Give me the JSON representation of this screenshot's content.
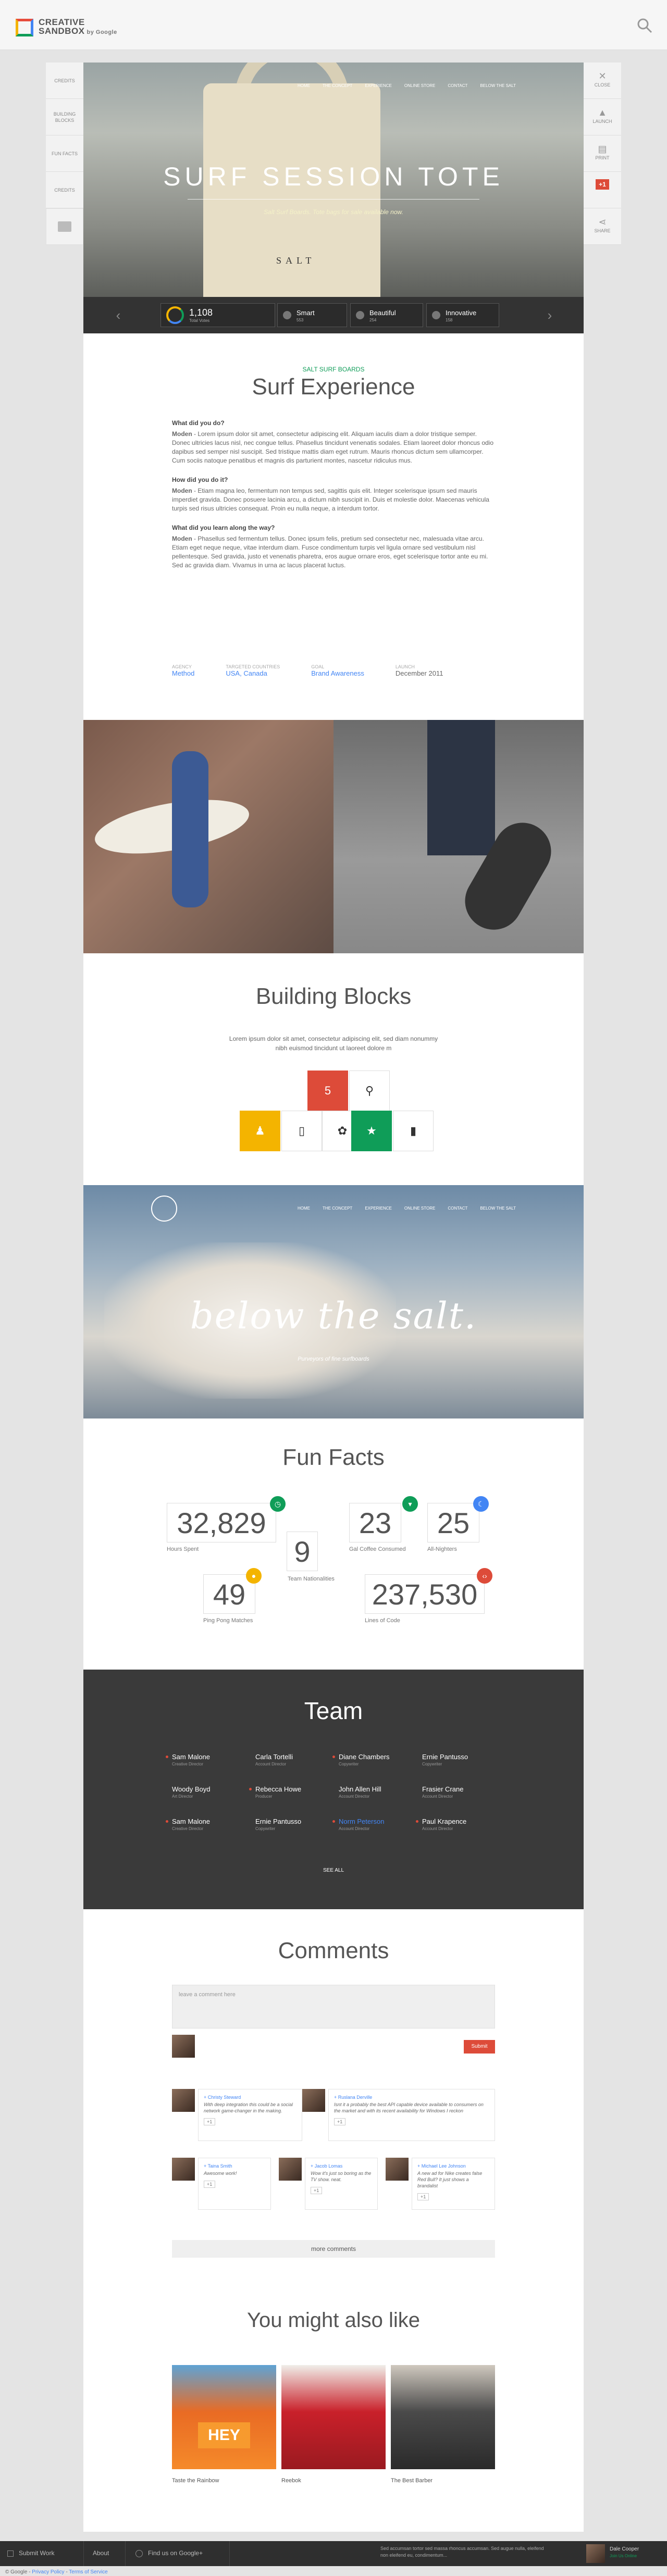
{
  "header": {
    "logo_line1": "CREATIVE",
    "logo_line2": "SANDBOX",
    "logo_by": "by Google"
  },
  "left_tabs": [
    "Credits",
    "Building Blocks",
    "Fun Facts",
    "Credits"
  ],
  "right_tabs": [
    {
      "icon": "close-icon",
      "label": "Close"
    },
    {
      "icon": "launch-icon",
      "label": "Launch"
    },
    {
      "icon": "print-icon",
      "label": "Print"
    },
    {
      "icon": "gplus-icon",
      "label": "+1"
    },
    {
      "icon": "share-icon",
      "label": "Share"
    }
  ],
  "hero": {
    "nav": [
      "Home",
      "The Concept",
      "Experience",
      "Online Store",
      "Contact",
      "Below the Salt"
    ],
    "title": "SURF SESSION TOTE",
    "subtitle": "Salt Surf Boards. Tote bags for sale available now."
  },
  "statbar": {
    "count": "1,108",
    "count_caption": "Total Votes",
    "items": [
      {
        "label": "Smart",
        "caption": "553"
      },
      {
        "label": "Beautiful",
        "caption": "254"
      },
      {
        "label": "Innovative",
        "caption": "158"
      }
    ]
  },
  "experience": {
    "tag": "Salt Surf Boards",
    "title": "Surf Experience",
    "sections": [
      {
        "q": "What did you do?",
        "lead": "Moden",
        "text": " - Lorem ipsum dolor sit amet, consectetur adipiscing elit. Aliquam iaculis diam a dolor tristique semper. Donec ultricies lacus nisl, nec congue tellus. Phasellus tincidunt venenatis sodales. Etiam laoreet dolor rhoncus odio dapibus sed semper nisl suscipit. Sed tristique mattis diam eget rutrum. Mauris rhoncus dictum sem ullamcorper. Cum sociis natoque penatibus et magnis dis parturient montes, nascetur ridiculus mus."
      },
      {
        "q": "How did you do it?",
        "lead": "Moden",
        "text": " - Etiam magna leo, fermentum non tempus sed, sagittis quis elit. Integer scelerisque ipsum sed mauris imperdiet gravida. Donec posuere lacinia arcu, a dictum nibh suscipit in. Duis et molestie dolor. Maecenas vehicula turpis sed risus ultricies consequat. Proin eu nulla neque, a interdum tortor."
      },
      {
        "q": "What did you learn along the way?",
        "lead": "Moden",
        "text": " - Phasellus sed fermentum tellus. Donec ipsum felis, pretium sed consectetur nec, malesuada vitae arcu. Etiam eget neque neque, vitae interdum diam. Fusce condimentum turpis vel ligula ornare sed vestibulum nisl pellentesque. Sed gravida, justo et venenatis pharetra, eros augue ornare eros, eget scelerisque tortor ante eu mi. Sed ac gravida diam. Vivamus in urna ac lacus placerat luctus."
      }
    ],
    "meta": [
      {
        "label": "Agency",
        "value": "Method",
        "link": true
      },
      {
        "label": "Targeted Countries",
        "value": "USA, Canada",
        "link": true
      },
      {
        "label": "Goal",
        "value": "Brand Awareness",
        "link": true
      },
      {
        "label": "Launch",
        "value": "December 2011",
        "link": false
      }
    ]
  },
  "building_blocks": {
    "title": "Building Blocks",
    "text": "Lorem ipsum dolor sit amet, consectetur adipiscing elit, sed diam nonummy nibh euismod tincidunt ut laoreet dolore m",
    "blocks": [
      {
        "icon": "html5-icon",
        "glyph": "5"
      },
      {
        "icon": "map-pin-icon",
        "glyph": "⚲"
      },
      {
        "icon": "android-icon",
        "glyph": "♟"
      },
      {
        "icon": "mobile-icon",
        "glyph": "▯"
      },
      {
        "icon": "chrome-icon",
        "glyph": "✿"
      },
      {
        "icon": "star-icon",
        "glyph": "★"
      },
      {
        "icon": "mouse-icon",
        "glyph": "▮"
      }
    ]
  },
  "salt": {
    "nav": [
      "Home",
      "The Concept",
      "Experience",
      "Online Store",
      "Contact",
      "Below the Salt"
    ],
    "script": "below the salt.",
    "sub": "Purveyors of fine surfboards"
  },
  "fun_facts": {
    "title": "Fun Facts",
    "facts": [
      {
        "value": "32,829",
        "label": "Hours Spent"
      },
      {
        "value": "9",
        "label": "Team Nationalities"
      },
      {
        "value": "23",
        "label": "Gal Coffee Consumed"
      },
      {
        "value": "25",
        "label": "All-Nighters"
      },
      {
        "value": "49",
        "label": "Ping Pong Matches"
      },
      {
        "value": "237,530",
        "label": "Lines of Code"
      }
    ]
  },
  "team": {
    "title": "Team",
    "members": [
      {
        "name": "Sam Malone",
        "role": "Creative Director"
      },
      {
        "name": "Carla Tortelli",
        "role": "Account Director"
      },
      {
        "name": "Diane Chambers",
        "role": "Copywriter"
      },
      {
        "name": "Ernie Pantusso",
        "role": "Copywriter"
      },
      {
        "name": "Woody Boyd",
        "role": "Art Director"
      },
      {
        "name": "Rebecca Howe",
        "role": "Producer"
      },
      {
        "name": "John Allen Hill",
        "role": "Account Director"
      },
      {
        "name": "Frasier Crane",
        "role": "Account Director"
      },
      {
        "name": "Sam Malone",
        "role": "Creative Director"
      },
      {
        "name": "Ernie Pantusso",
        "role": "Copywriter"
      },
      {
        "name": "Norm Peterson",
        "role": "Account Director"
      },
      {
        "name": "Paul Krapence",
        "role": "Account Director"
      }
    ],
    "see_all": "See All"
  },
  "comments": {
    "title": "Comments",
    "placeholder": "leave a comment here",
    "submit": "Submit",
    "items": [
      {
        "name": "+ Christy Steward",
        "text": "With deep integration this could be a social network game-changer in the making.",
        "plus": "+1"
      },
      {
        "name": "+ Ruslana Derville",
        "text": "Isnt it a probably the best API capable device available to consumers on the market and with its recent availability for Windows I reckon",
        "plus": "+1"
      },
      {
        "name": "+ Taina Smith",
        "text": "Awesome work!",
        "plus": "+1"
      },
      {
        "name": "+ Jacob Lomas",
        "text": "Wow it's just so boring as the TV show. neat.",
        "plus": "+1"
      },
      {
        "name": "+ Michael Lee Johnson",
        "text": "A new ad for Nike creates false Red Bull? It just shows a brandalist",
        "plus": "+1"
      }
    ],
    "more": "more comments"
  },
  "also_like": {
    "title": "You might also like",
    "items": [
      {
        "caption": "Taste the Rainbow",
        "badge": "HEY"
      },
      {
        "caption": "Reebok"
      },
      {
        "caption": "The Best Barber"
      }
    ]
  },
  "footer": {
    "submit": "Submit Work",
    "about": "About",
    "find": "Find us on Google+",
    "message": "Sed accumsan tortor sed massa rhoncus accumsan. Sed augue nulla, eleifend non eleifend eu, condimentum...",
    "user_name": "Dale Cooper",
    "user_status": "Join Us Online",
    "legal_google": "© Google",
    "privacy": "Privacy Policy",
    "terms": "Terms of Service"
  },
  "colors": {
    "red": "#dd4b39",
    "green": "#0f9d58",
    "blue": "#4285f4",
    "yellow": "#f4b400",
    "dark": "#3a3a3a"
  }
}
